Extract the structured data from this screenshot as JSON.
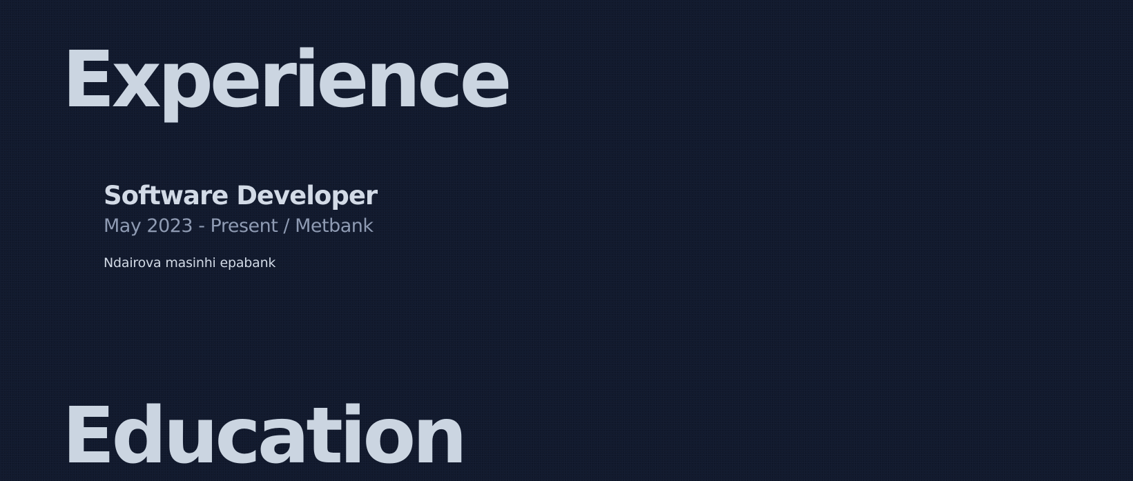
{
  "experience": {
    "heading": "Experience",
    "jobs": [
      {
        "title": "Software Developer",
        "meta": "May 2023 - Present / Metbank",
        "description": "Ndairova masinhi epabank"
      }
    ]
  },
  "education": {
    "heading": "Education"
  },
  "colors": {
    "background": "#111a2e",
    "heading": "#cbd5e1",
    "title": "#d2dae6",
    "meta": "#8f9bb3"
  }
}
